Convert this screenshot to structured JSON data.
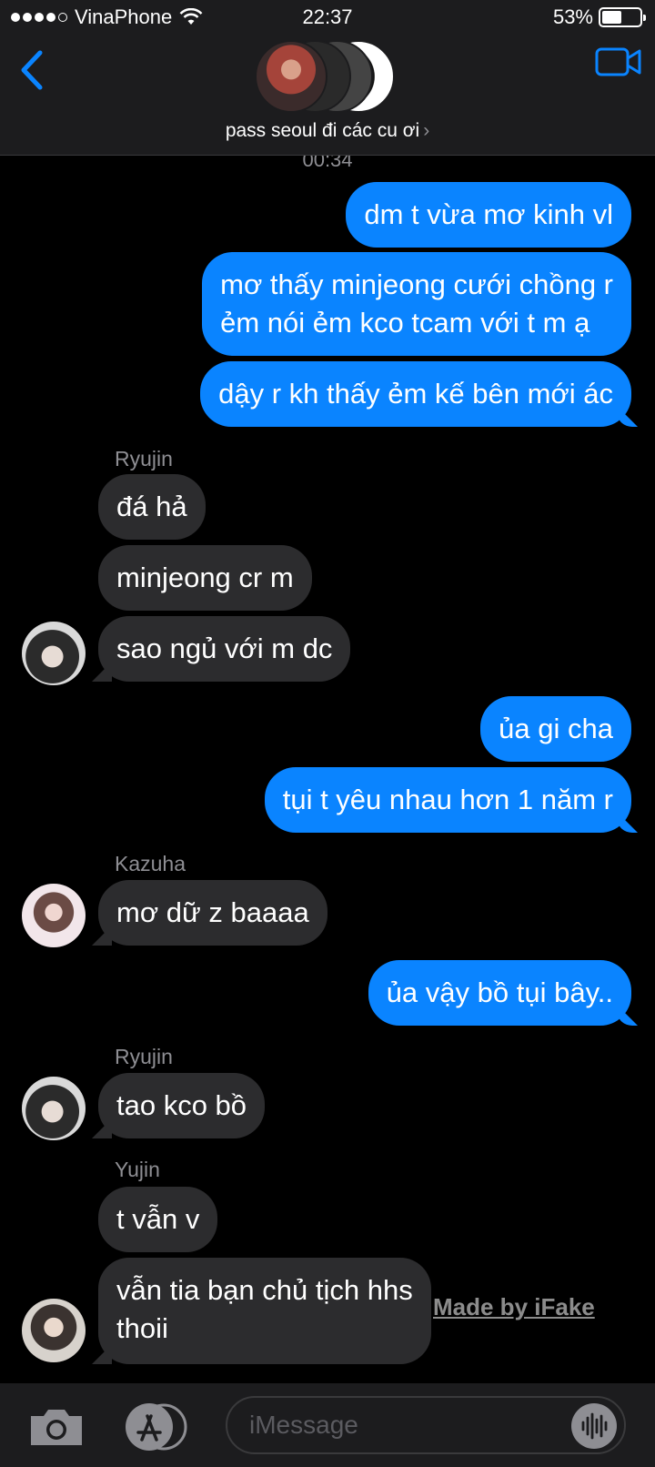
{
  "status_bar": {
    "carrier": "VinaPhone",
    "time": "22:37",
    "battery": "53%",
    "battery_level": 0.53
  },
  "header": {
    "group_name": "pass seoul đi các cu ơi",
    "chevron": "›"
  },
  "thread": {
    "timestamp": "00:34",
    "messages": [
      {
        "dir": "out",
        "lines": [
          "dm t vừa mơ kinh vl"
        ]
      },
      {
        "dir": "out",
        "lines": [
          "mơ thấy minjeong cưới chồng r",
          "ẻm nói ẻm kco tcam với t m ạ"
        ]
      },
      {
        "dir": "out",
        "lines": [
          "dậy r kh thấy ẻm kế bên mới ác"
        ]
      },
      {
        "dir": "in",
        "sender": "Ryujin",
        "lines": [
          "đá hả"
        ]
      },
      {
        "dir": "in",
        "lines": [
          "minjeong cr m"
        ]
      },
      {
        "dir": "in",
        "lines": [
          "sao ngủ với m dc"
        ]
      },
      {
        "dir": "out",
        "lines": [
          "ủa gi cha"
        ]
      },
      {
        "dir": "out",
        "lines": [
          "tụi t yêu nhau hơn 1 năm r"
        ]
      },
      {
        "dir": "in",
        "sender": "Kazuha",
        "lines": [
          "mơ dữ z baaaa"
        ]
      },
      {
        "dir": "out",
        "lines": [
          "ủa vậy bồ tụi bây.."
        ]
      },
      {
        "dir": "in",
        "sender": "Ryujin",
        "lines": [
          "tao kco bồ"
        ]
      },
      {
        "dir": "in",
        "sender": "Yujin",
        "lines": [
          "t vẫn v"
        ]
      },
      {
        "dir": "in",
        "lines": [
          "vẫn tia bạn chủ tịch hhs",
          "thoii"
        ]
      }
    ]
  },
  "watermark": "Made by iFake",
  "input_bar": {
    "placeholder": "iMessage"
  },
  "icons": {
    "back": "chevron-left-icon",
    "video": "video-camera-icon",
    "camera": "camera-icon",
    "apps": "app-store-icon",
    "audio": "waveform-icon"
  },
  "colors": {
    "accent": "#0a84ff",
    "outgoing_bubble": "#0a84ff",
    "incoming_bubble": "#2c2c2e",
    "background": "#000000",
    "bar": "#1c1c1e"
  }
}
